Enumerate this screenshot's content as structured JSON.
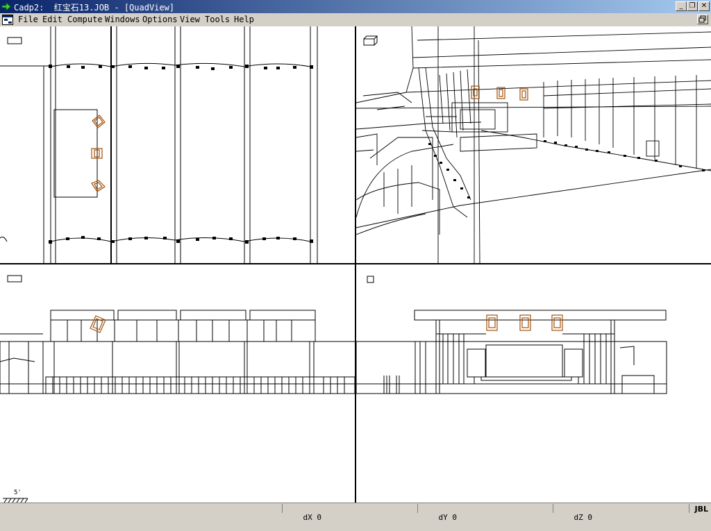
{
  "window": {
    "title": "Cadp2:  红宝石13.JOB - [QuadView]",
    "minimize_glyph": "_",
    "maximize_glyph": "❐",
    "close_glyph": "✕"
  },
  "menu": {
    "items": [
      "File",
      "Edit",
      "Compute",
      "Windows",
      "Options",
      "View",
      "Tools",
      "Help"
    ]
  },
  "viewports": [
    {
      "name": "top-view",
      "view_icon": "flat-rect-icon"
    },
    {
      "name": "perspective-view",
      "view_icon": "box-3d-icon"
    },
    {
      "name": "front-view",
      "view_icon": "flat-rect-icon"
    },
    {
      "name": "side-view",
      "view_icon": "square-icon"
    }
  ],
  "scale": {
    "label": "5'"
  },
  "status": {
    "dx_label": "dX",
    "dx_value": "0",
    "dy_label": "dY",
    "dy_value": "0",
    "dz_label": "dZ",
    "dz_value": "0",
    "brand": "JBL"
  },
  "colors": {
    "titlebar_start": "#0a246a",
    "speaker": "#a0500a",
    "wire": "#000000"
  }
}
